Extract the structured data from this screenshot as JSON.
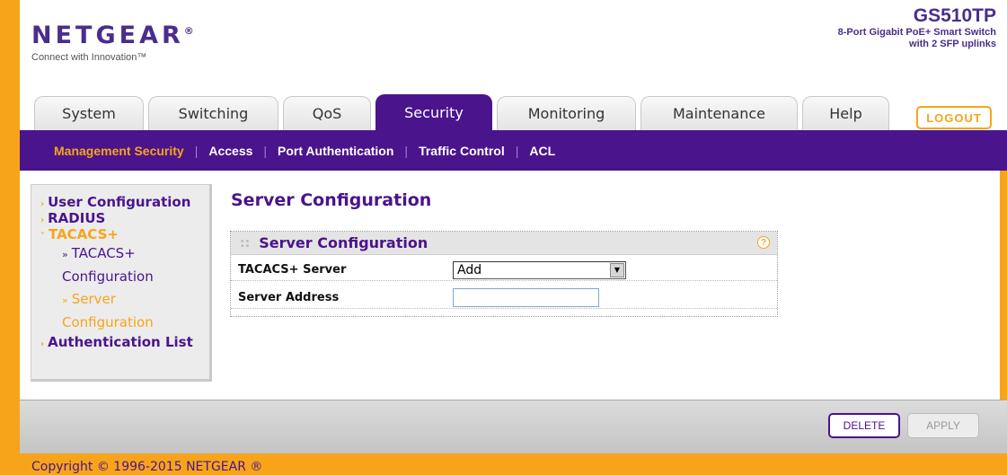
{
  "brand": {
    "logo": "NETGEAR",
    "trademark": "®",
    "tagline": "Connect with Innovation™",
    "model": "GS510TP",
    "model_desc_line1": "8-Port Gigabit PoE+ Smart Switch",
    "model_desc_line2": "with 2 SFP uplinks"
  },
  "tabs": [
    {
      "label": "System"
    },
    {
      "label": "Switching"
    },
    {
      "label": "QoS"
    },
    {
      "label": "Security"
    },
    {
      "label": "Monitoring"
    },
    {
      "label": "Maintenance"
    },
    {
      "label": "Help"
    }
  ],
  "logout_label": "LOGOUT",
  "subnav": [
    {
      "label": "Management Security"
    },
    {
      "label": "Access"
    },
    {
      "label": "Port Authentication"
    },
    {
      "label": "Traffic Control"
    },
    {
      "label": "ACL"
    }
  ],
  "menu": {
    "items": [
      {
        "label": "User Configuration"
      },
      {
        "label": "RADIUS"
      },
      {
        "label": "TACACS+"
      },
      {
        "label": "Authentication List"
      }
    ],
    "sub": [
      {
        "line1": "TACACS+",
        "line2": "Configuration"
      },
      {
        "line1": "Server",
        "line2": "Configuration"
      }
    ]
  },
  "page_title": "Server Configuration",
  "box": {
    "title": "Server Configuration",
    "help": "?",
    "rows": [
      {
        "label": "TACACS+ Server",
        "value": "Add"
      },
      {
        "label": "Server Address",
        "value": ""
      }
    ]
  },
  "buttons": {
    "delete": "DELETE",
    "apply": "APPLY"
  },
  "footer": "Copyright © 1996-2015 NETGEAR ®",
  "colors": {
    "purple": "#4a148c",
    "orange": "#f7a41b"
  }
}
